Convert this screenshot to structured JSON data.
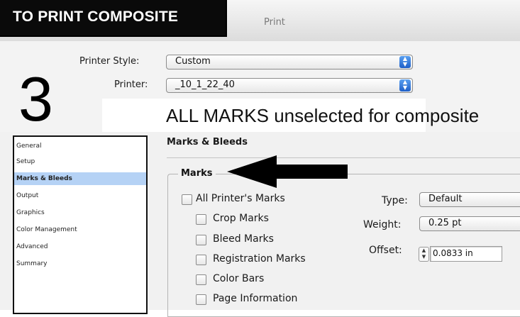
{
  "banner": {
    "text": "TO PRINT COMPOSITE"
  },
  "window": {
    "title": "Print"
  },
  "step_number": "3",
  "printer_style": {
    "label": "Printer Style:",
    "value": "Custom"
  },
  "printer": {
    "label": "Printer:",
    "value": "_10_1_22_40"
  },
  "annotation": "ALL MARKS unselected for composite",
  "sidebar": {
    "items": [
      {
        "label": "General",
        "selected": false
      },
      {
        "label": "Setup",
        "selected": false
      },
      {
        "label": "Marks & Bleeds",
        "selected": true
      },
      {
        "label": "Output",
        "selected": false
      },
      {
        "label": "Graphics",
        "selected": false
      },
      {
        "label": "Color Management",
        "selected": false
      },
      {
        "label": "Advanced",
        "selected": false
      },
      {
        "label": "Summary",
        "selected": false
      }
    ]
  },
  "panel": {
    "title": "Marks & Bleeds",
    "marks_group": "Marks",
    "checkboxes": [
      {
        "label": "All Printer's Marks",
        "checked": false
      },
      {
        "label": "Crop Marks",
        "checked": false
      },
      {
        "label": "Bleed Marks",
        "checked": false
      },
      {
        "label": "Registration Marks",
        "checked": false
      },
      {
        "label": "Color Bars",
        "checked": false
      },
      {
        "label": "Page Information",
        "checked": false
      }
    ],
    "type": {
      "label": "Type:",
      "value": "Default"
    },
    "weight": {
      "label": "Weight:",
      "value": "0.25 pt"
    },
    "offset": {
      "label": "Offset:",
      "value": "0.0833 in"
    }
  },
  "colors": {
    "banner": "#0a0a0a",
    "selection": "#b5d2f5",
    "popup_arrows": "#1e5fc8"
  }
}
